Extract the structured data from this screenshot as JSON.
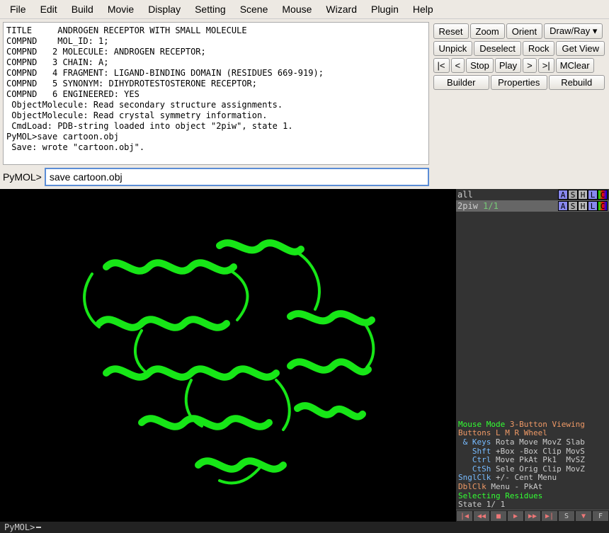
{
  "menubar": [
    "File",
    "Edit",
    "Build",
    "Movie",
    "Display",
    "Setting",
    "Scene",
    "Mouse",
    "Wizard",
    "Plugin",
    "Help"
  ],
  "console_output": "TITLE     ANDROGEN RECEPTOR WITH SMALL MOLECULE\nCOMPND    MOL_ID: 1;\nCOMPND   2 MOLECULE: ANDROGEN RECEPTOR;\nCOMPND   3 CHAIN: A;\nCOMPND   4 FRAGMENT: LIGAND-BINDING DOMAIN (RESIDUES 669-919);\nCOMPND   5 SYNONYM: DIHYDROTESTOSTERONE RECEPTOR;\nCOMPND   6 ENGINEERED: YES\n ObjectMolecule: Read secondary structure assignments.\n ObjectMolecule: Read crystal symmetry information.\n CmdLoad: PDB-string loaded into object \"2piw\", state 1.\nPyMOL>save cartoon.obj\n Save: wrote \"cartoon.obj\".",
  "console_prompt": "PyMOL>",
  "console_input": "save cartoon.obj",
  "buttons": {
    "row1": [
      "Reset",
      "Zoom",
      "Orient",
      "Draw/Ray ▾"
    ],
    "row2": [
      "Unpick",
      "Deselect",
      "Rock",
      "Get View"
    ],
    "row3": [
      "|<",
      "<",
      "Stop",
      "Play",
      ">",
      ">|",
      "MClear"
    ],
    "row4": [
      "Builder",
      "Properties",
      "Rebuild"
    ]
  },
  "objects": [
    {
      "name": "all",
      "frac": "",
      "selected": false
    },
    {
      "name": "2piw",
      "frac": "1/1",
      "selected": true
    }
  ],
  "obj_button_labels": [
    "A",
    "S",
    "H",
    "L",
    "C"
  ],
  "mouse_panel": {
    "title_l": "Mouse Mode",
    "title_r": "3-Button Viewing",
    "hdr_l": "Buttons",
    "hdr_cols": "L    M    R  Wheel",
    "rows": [
      {
        "k": "& Keys",
        "v": "Rota Move MovZ Slab"
      },
      {
        "k": "Shft",
        "v": "+Box -Box Clip MovS"
      },
      {
        "k": "Ctrl",
        "v": "Move PkAt Pk1  MvSZ"
      },
      {
        "k": "CtSh",
        "v": "Sele Orig Clip MovZ"
      }
    ],
    "sngl_l": "SnglClk",
    "sngl_r": "+/-       Cent Menu",
    "dbl_l": "DblClk",
    "dbl_r": "Menu   -       PkAt",
    "sel": "Selecting Residues",
    "state": "State    1/    1"
  },
  "bottom_prompt": "PyMOL>"
}
